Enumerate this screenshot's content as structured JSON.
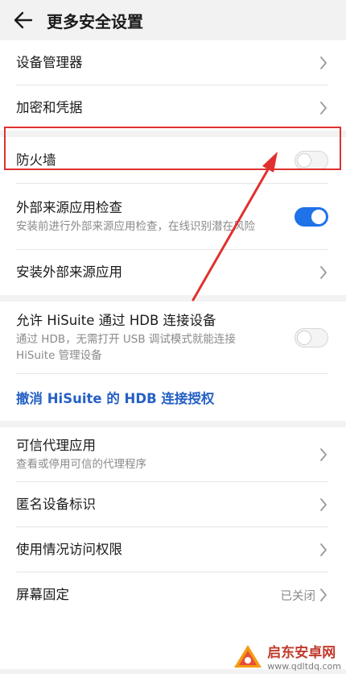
{
  "header": {
    "title": "更多安全设置",
    "back_icon": "arrow-left-icon"
  },
  "items": {
    "device_manager": "设备管理器",
    "encryption": "加密和凭据",
    "firewall": "防火墙",
    "external_check": {
      "title": "外部来源应用检查",
      "subtitle": "安装前进行外部来源应用检查，在线识别潜在风险"
    },
    "install_external": "安装外部来源应用",
    "hisuite_hdb": {
      "title": "允许 HiSuite 通过 HDB 连接设备",
      "subtitle": "通过 HDB，无需打开 USB 调试模式就能连接 HiSuite 管理设备"
    },
    "revoke_hdb": "撤消 HiSuite 的 HDB 连接授权",
    "trusted_agents": {
      "title": "可信代理应用",
      "subtitle": "查看或停用可信的代理程序"
    },
    "anonymous_id": "匿名设备标识",
    "usage_access": "使用情况访问权限",
    "screen_pinning": {
      "title": "屏幕固定",
      "status": "已关闭"
    }
  },
  "toggles": {
    "firewall": false,
    "external_check": true,
    "hisuite_hdb": false
  },
  "colors": {
    "accent": "#1f72e8",
    "link": "#2561c4",
    "highlight": "#e0312f"
  },
  "watermark": {
    "name": "启东安卓网",
    "url": "www.qdltdq.com"
  }
}
